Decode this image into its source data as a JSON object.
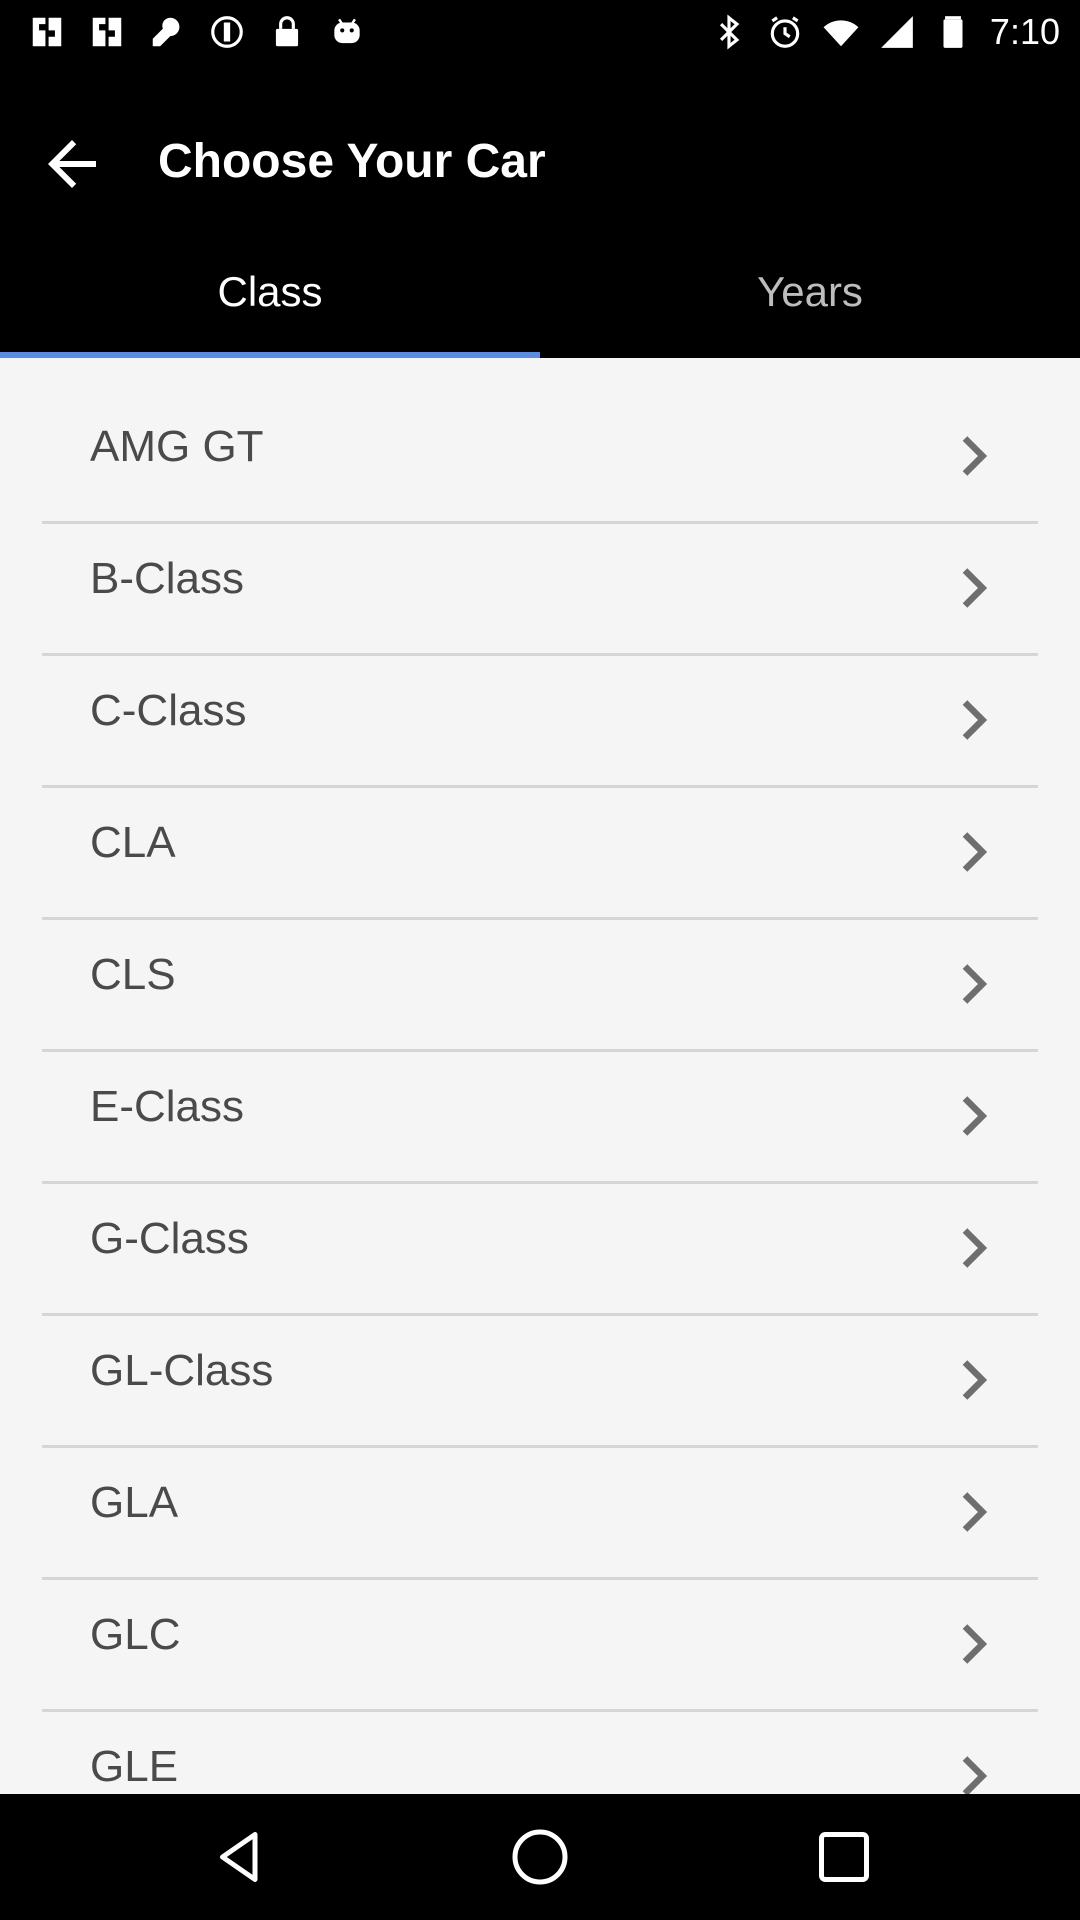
{
  "status_bar": {
    "time": "7:10",
    "left_icons": [
      "app-notification-icon",
      "app-notification-icon",
      "wrench-icon",
      "record-icon",
      "lock-icon",
      "android-icon"
    ],
    "right_icons": [
      "bluetooth-icon",
      "alarm-icon",
      "wifi-icon",
      "signal-icon",
      "battery-icon"
    ]
  },
  "app_bar": {
    "title": "Choose Your Car",
    "back_icon": "back-arrow-icon"
  },
  "tabs": [
    {
      "label": "Class",
      "active": true
    },
    {
      "label": "Years",
      "active": false
    }
  ],
  "colors": {
    "tab_indicator": "#5c8de0",
    "background": "#000000",
    "list_background": "#f5f5f5"
  },
  "car_classes": [
    {
      "label": "AMG GT"
    },
    {
      "label": "B-Class"
    },
    {
      "label": "C-Class"
    },
    {
      "label": "CLA"
    },
    {
      "label": "CLS"
    },
    {
      "label": "E-Class"
    },
    {
      "label": "G-Class"
    },
    {
      "label": "GL-Class"
    },
    {
      "label": "GLA"
    },
    {
      "label": "GLC"
    },
    {
      "label": "GLE"
    }
  ],
  "nav_bar": {
    "icons": [
      "back-triangle-icon",
      "home-circle-icon",
      "recents-square-icon"
    ]
  }
}
